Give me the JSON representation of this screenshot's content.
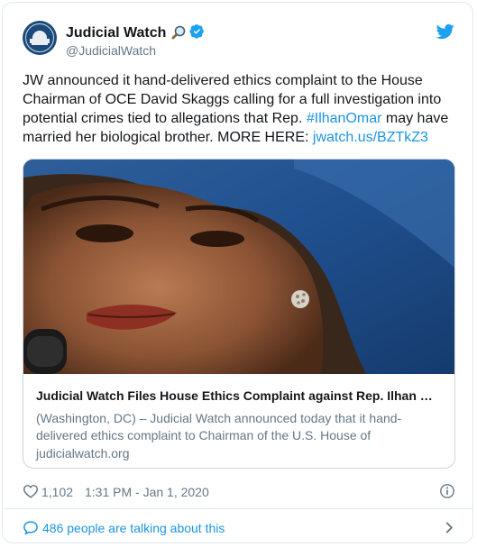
{
  "account": {
    "name": "Judicial Watch",
    "handle": "@JudicialWatch",
    "name_emoji": "magnifying-glass-icon",
    "verified_icon": "verified-badge-icon",
    "platform_icon": "twitter-bird-icon"
  },
  "tweet": {
    "text_part1": "JW announced it hand-delivered ethics complaint to the House Chairman of OCE David Skaggs calling for a full investigation into potential crimes tied to allegations that Rep. ",
    "hashtag": "#IlhanOmar",
    "text_part2": " may have married her biological brother. MORE HERE: ",
    "link": "jwatch.us/BZTkZ3"
  },
  "link_card": {
    "title": "Judicial Watch Files House Ethics Complaint against Rep. Ilhan Omar",
    "description": "(Washington, DC) – Judicial Watch announced today that it hand-delivered ethics complaint to Chairman of the U.S. House of",
    "domain": "judicialwatch.org"
  },
  "footer": {
    "likes": "1,102",
    "timestamp": "1:31 PM - Jan 1, 2020",
    "talking": "486 people are talking about this"
  },
  "colors": {
    "link_blue": "#1b95e0",
    "text_primary": "#14171a",
    "text_secondary": "#657786",
    "border": "#e1e8ed"
  }
}
